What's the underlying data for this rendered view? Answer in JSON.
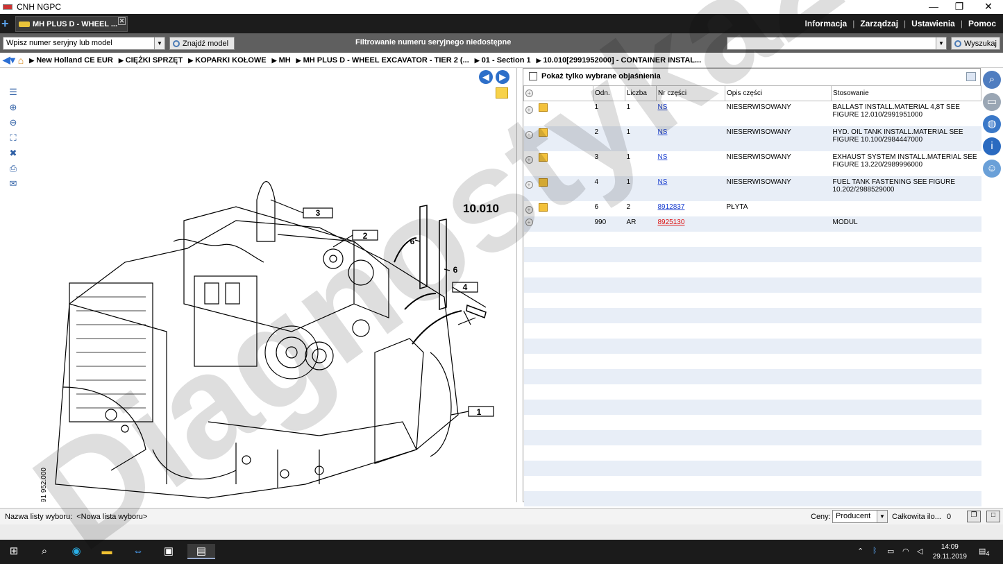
{
  "window": {
    "title": "CNH NGPC",
    "controls": [
      "—",
      "❐",
      "✕"
    ]
  },
  "tabs": {
    "plus": "+",
    "active": "MH PLUS D - WHEEL ...",
    "close": "✕"
  },
  "menu": {
    "info": "Informacja",
    "manage": "Zarządzaj",
    "settings": "Ustawienia",
    "help": "Pomoc"
  },
  "toolbar": {
    "serial_value": "Wpisz numer seryjny lub model",
    "find_label": "Znajdź model",
    "filter_text": "Filtrowanie numeru seryjnego niedostępne",
    "search_value": "",
    "search_label": "Wyszukaj"
  },
  "breadcrumb": [
    "New Holland CE EUR",
    "CIĘŻKI SPRZĘT",
    "KOPARKI KOŁOWE",
    "MH",
    "MH PLUS D - WHEEL EXCAVATOR - TIER 2 (...",
    "01 - Section 1",
    "10.010[2991952000] - CONTAINER INSTAL..."
  ],
  "drawing": {
    "figure": "10.010",
    "code": "2 991 952.000",
    "callouts": [
      "1",
      "2",
      "3",
      "4",
      "6",
      "6"
    ]
  },
  "panel": {
    "show_only_label": "Pokaż tylko wybrane objaśnienia"
  },
  "table": {
    "headers": [
      "",
      "Odn.",
      "Liczba",
      "Nr części",
      "Opis części",
      "Stosowanie"
    ],
    "rows": [
      {
        "ref": "1",
        "qty": "1",
        "part": "NS",
        "desc": "NIESERWISOWANY",
        "use": "BALLAST INSTALL.MATERIAL 4,8T SEE FIGURE 12.010/2991951000",
        "icon": true,
        "red": false
      },
      {
        "ref": "2",
        "qty": "1",
        "part": "NS",
        "desc": "NIESERWISOWANY",
        "use": "HYD. OIL TANK INSTALL.MATERIAL SEE FIGURE 10.100/2984447000",
        "icon": true,
        "red": false
      },
      {
        "ref": "3",
        "qty": "1",
        "part": "NS",
        "desc": "NIESERWISOWANY",
        "use": "EXHAUST SYSTEM INSTALL.MATERIAL SEE FIGURE 13.220/2989996000",
        "icon": true,
        "red": false
      },
      {
        "ref": "4",
        "qty": "1",
        "part": "NS",
        "desc": "NIESERWISOWANY",
        "use": "FUEL TANK FASTENING SEE FIGURE 10.202/2988529000",
        "icon": true,
        "red": false
      },
      {
        "ref": "6",
        "qty": "2",
        "part": "8912837",
        "desc": "PŁYTA",
        "use": "",
        "icon": true,
        "red": false
      },
      {
        "ref": "990",
        "qty": "AR",
        "part": "8925130",
        "desc": "",
        "use": "MODUL",
        "icon": false,
        "red": true
      }
    ]
  },
  "bottom": {
    "list_label": "Nazwa listy wyboru:",
    "list_value": "<Nowa lista wyboru>",
    "prices_label": "Ceny:",
    "prices_value": "Producent",
    "total_label": "Całkowita ilo...",
    "total_value": "0"
  },
  "taskbar": {
    "time": "14:09",
    "date": "29.11.2019",
    "notif": "4"
  },
  "watermark": "Diagnostyka24"
}
